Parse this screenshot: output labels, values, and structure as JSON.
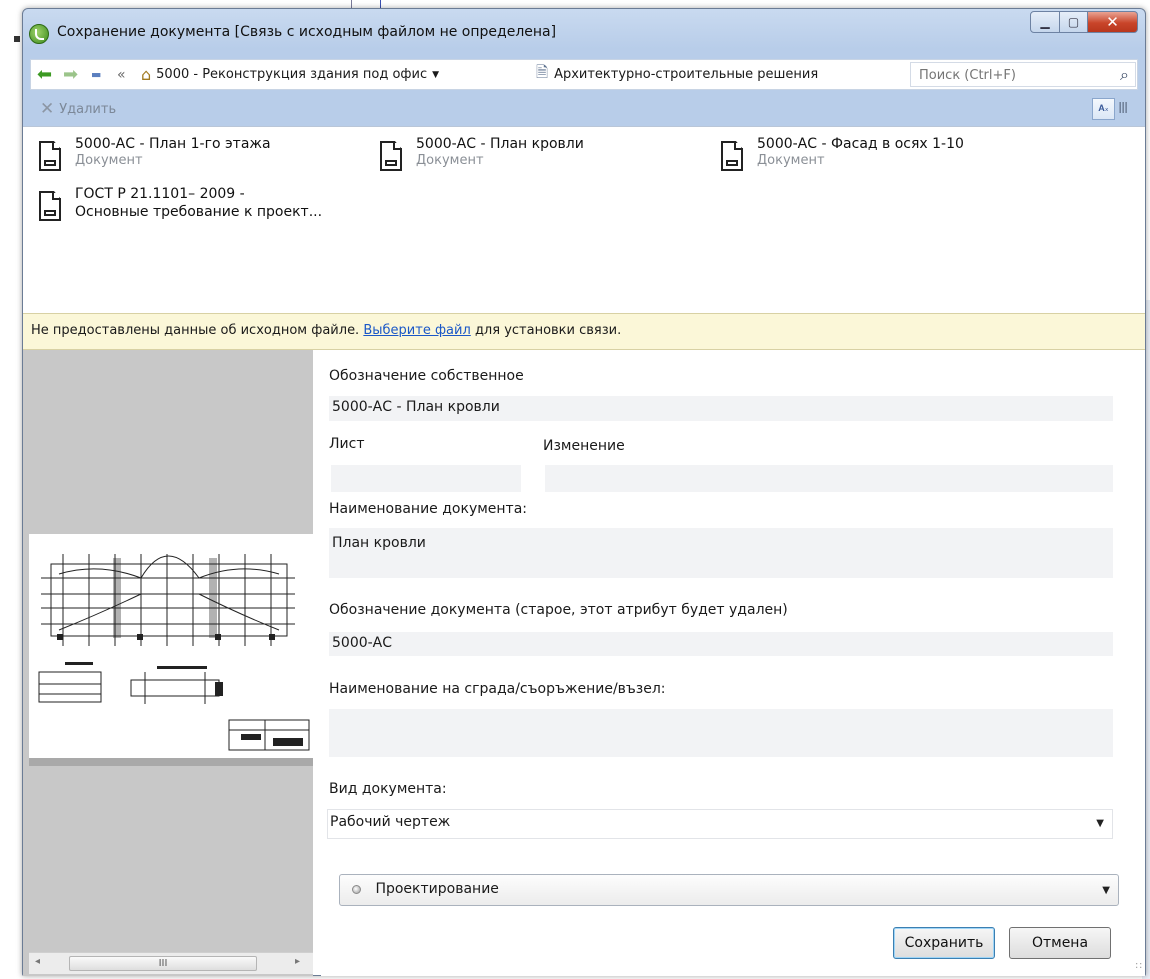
{
  "window": {
    "title": "Сохранение документа [Связь с исходным файлом не определена]",
    "close_glyph": "✕",
    "minimize_glyph": "▁",
    "maximize_glyph": "▢"
  },
  "nav": {
    "back_icon": "back-arrow-icon",
    "forward_icon": "forward-arrow-icon",
    "collapse_glyph": "«",
    "breadcrumb_1": "5000 - Реконструкция здания под офис",
    "breadcrumb_2": "Архитектурно-строительные решения",
    "search_placeholder": "Поиск (Ctrl+F)"
  },
  "toolbar": {
    "delete_label": "Удалить"
  },
  "files": [
    {
      "name": "5000-АС - План 1-го этажа",
      "type": "Документ"
    },
    {
      "name": "5000-АС - План кровли",
      "type": "Документ"
    },
    {
      "name": "5000-АС - Фасад в осях 1-10",
      "type": "Документ"
    },
    {
      "name_line1": "ГОСТ Р 21.1101– 2009 -",
      "name_line2": "Основные требование к проект..."
    }
  ],
  "warning": {
    "text_before": "Не предоставлены данные об исходном файле.",
    "link": "Выберите файл",
    "text_after": "для установки связи."
  },
  "form": {
    "designation_label": "Обозначение собственное",
    "designation_value": "5000-АС - План кровли",
    "sheet_label": "Лист",
    "sheet_value": "",
    "change_label": "Изменение",
    "change_value": "",
    "doc_name_label": "Наименование документа:",
    "doc_name_value": "План кровли",
    "old_designation_label": "Обозначение документа (старое, этот атрибут будет удален)",
    "old_designation_value": "5000-АС",
    "building_label": "Наименование на сграда/съоръжение/възел:",
    "building_value": "",
    "doc_type_label": "Вид документа:",
    "doc_type_value": "Рабочий чертеж",
    "stage_value": "Проектирование"
  },
  "buttons": {
    "save": "Сохранить",
    "cancel": "Отмена"
  },
  "scroll": {
    "thumb_glyph": "III"
  }
}
